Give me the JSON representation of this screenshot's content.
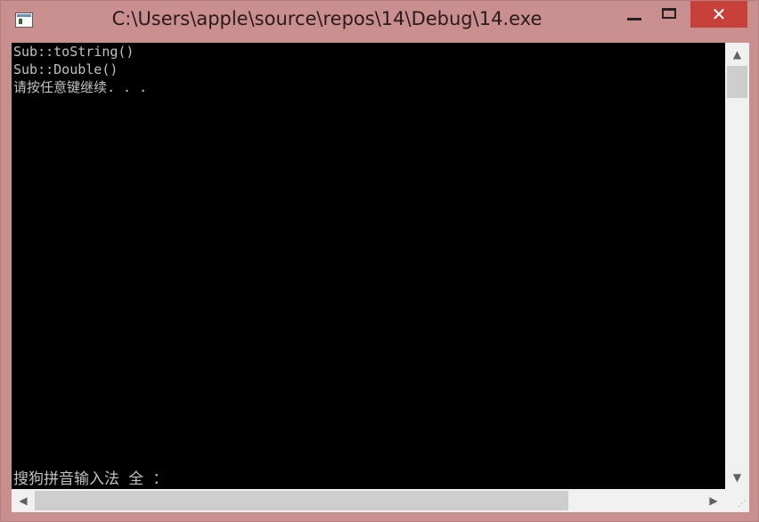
{
  "window": {
    "title": "C:\\Users\\apple\\source\\repos\\14\\Debug\\14.exe",
    "icon": "console-app-icon",
    "controls": {
      "minimize_icon": "minimize-icon",
      "maximize_icon": "maximize-icon",
      "close_label": "✕"
    }
  },
  "console": {
    "lines": [
      "Sub::toString()",
      "Sub::Double()",
      "请按任意键继续. . ."
    ],
    "ime_status": "搜狗拼音输入法 全 ："
  },
  "scrollbars": {
    "vertical": {
      "up_arrow": "▲",
      "down_arrow": "▼",
      "position": 0.0
    },
    "horizontal": {
      "left_arrow": "◀",
      "right_arrow": "▶",
      "position": 0.0
    },
    "size_grip": "⋰"
  },
  "colors": {
    "frame": "#c98f8f",
    "close_button": "#c7403a",
    "console_background": "#000000",
    "console_text": "#c0c0c0"
  }
}
